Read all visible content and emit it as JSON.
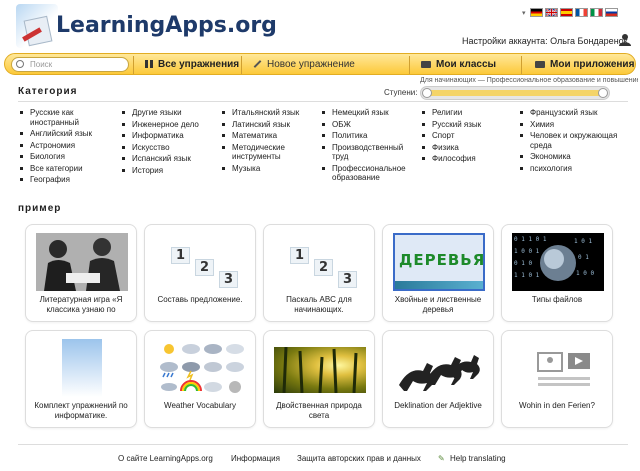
{
  "header": {
    "site_name": "LearningApps.org",
    "account_label": "Настройки аккаунта: Ольга Бондаренок",
    "flags": [
      "de",
      "gb",
      "es",
      "fr",
      "it",
      "ru"
    ]
  },
  "nav": {
    "search_placeholder": "Поиск",
    "all_exercises": "Все упражнения",
    "new_exercise": "Новое упражнение",
    "my_classes": "Мои классы",
    "my_apps": "Мои приложения"
  },
  "filter": {
    "category_title": "Категория",
    "levels_label": "Ступени:",
    "levels_note": "Для начинающих — Профессиональное образование и повышение к"
  },
  "categories": [
    [
      "Русские как иностранный",
      "Английский язык",
      "Астрономия",
      "Биология",
      "Все категории",
      "География"
    ],
    [
      "Другие языки",
      "Инженерное дело",
      "Информатика",
      "Искусство",
      "Испанский язык",
      "История"
    ],
    [
      "Итальянский язык",
      "Латинский язык",
      "Математика",
      "Методические инструменты",
      "Музыка"
    ],
    [
      "Немецкий язык",
      "ОБЖ",
      "Политика",
      "Производственный труд",
      "Профессиональное образование"
    ],
    [
      "Религии",
      "Русский язык",
      "Спорт",
      "Физика",
      "Философия"
    ],
    [
      "Французский язык",
      "Химия",
      "Человек и окружающая среда",
      "Экономика",
      "психология"
    ]
  ],
  "examples": {
    "title": "пример",
    "cards": [
      {
        "label": "Литературная игра «Я классика узнаю по",
        "thumb": "photo-bw"
      },
      {
        "label": "Составь предложение.",
        "thumb": "numbers"
      },
      {
        "label": "Паскаль ABC для начинающих.",
        "thumb": "numbers"
      },
      {
        "label": "Хвойные и лиственные деревья",
        "thumb": "trees",
        "thumb_text": "ДЕРЕВЬЯ"
      },
      {
        "label": "Типы файлов",
        "thumb": "binary"
      },
      {
        "label": "Комплект упражнений по информатике.",
        "thumb": "blue-fade"
      },
      {
        "label": "Weather Vocabulary",
        "thumb": "weather"
      },
      {
        "label": "Двойственная природа света",
        "thumb": "forest"
      },
      {
        "label": "Deklination der Adjektive",
        "thumb": "horses"
      },
      {
        "label": "Wohin in den Ferien?",
        "thumb": "media"
      }
    ]
  },
  "footer": {
    "about": "О сайте LearningApps.org",
    "info": "Информация",
    "copyright": "Защита авторских прав и данных",
    "help": "Help translating"
  }
}
